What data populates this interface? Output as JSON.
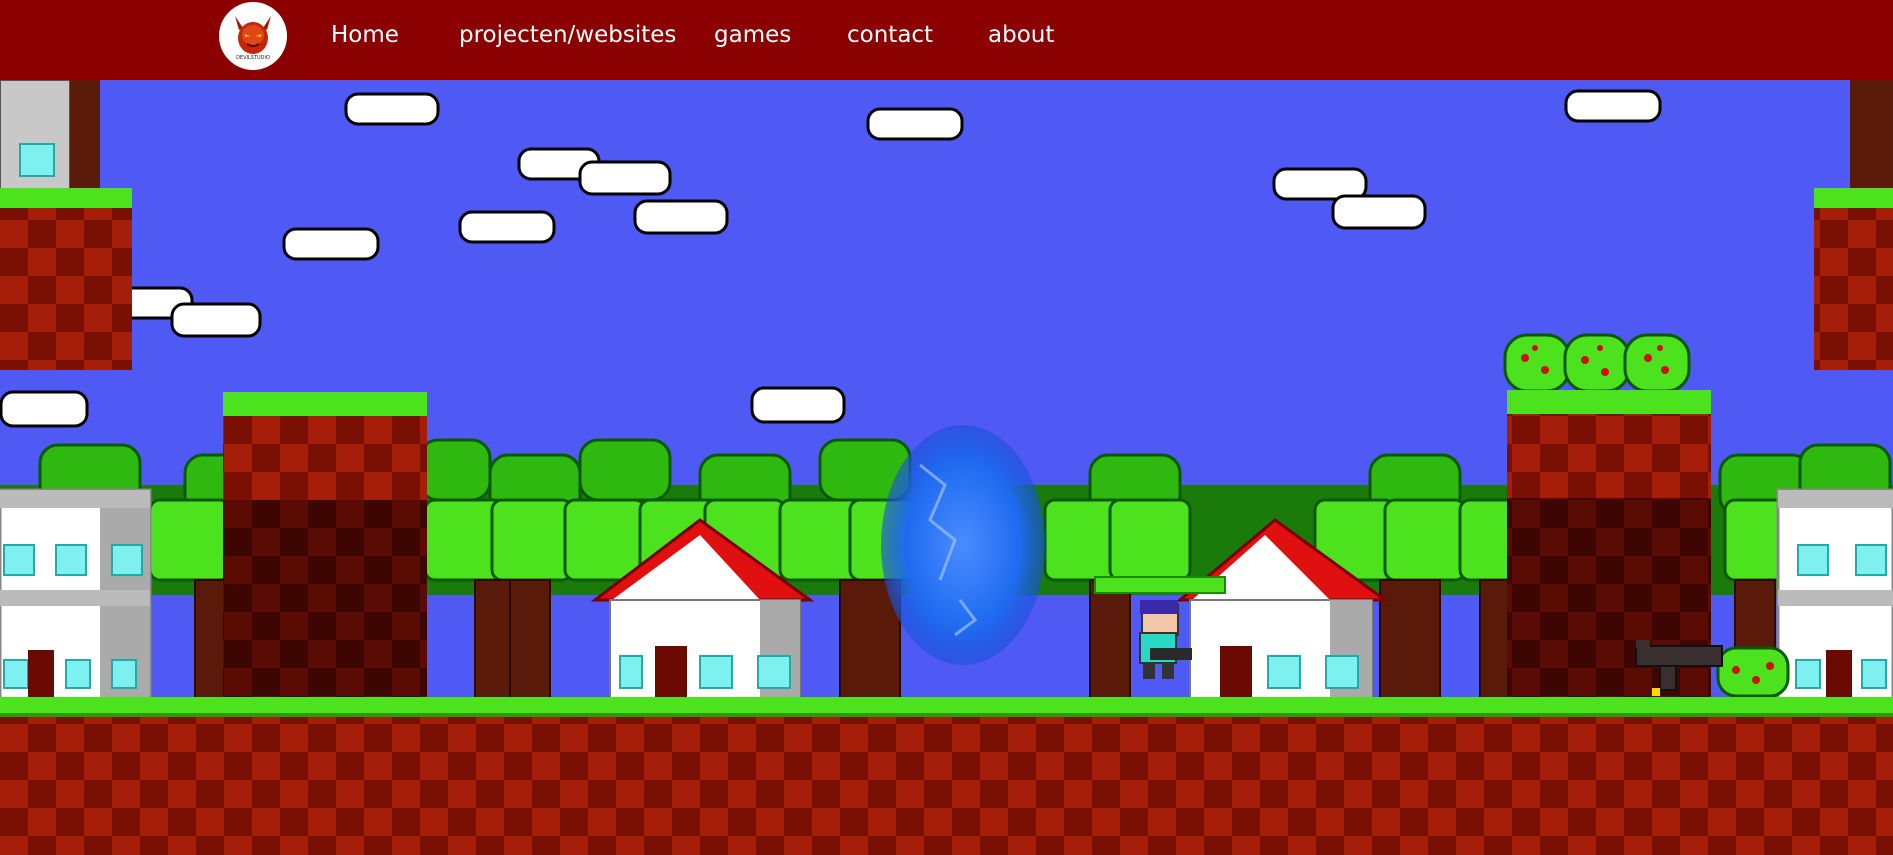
{
  "nav": {
    "logo_alt": "devil logo",
    "links": [
      {
        "label": "Home"
      },
      {
        "label": "projecten/websites"
      },
      {
        "label": "games"
      },
      {
        "label": "contact"
      },
      {
        "label": "about"
      }
    ]
  },
  "colors": {
    "navbar": "#8b0000",
    "sky": "#4f5af5",
    "grass": "#4de21e",
    "dirt_dark": "#7a1004",
    "dirt_light": "#a51e0a",
    "portal": "#1e6bf0"
  },
  "game": {
    "player_health": 1.0
  }
}
